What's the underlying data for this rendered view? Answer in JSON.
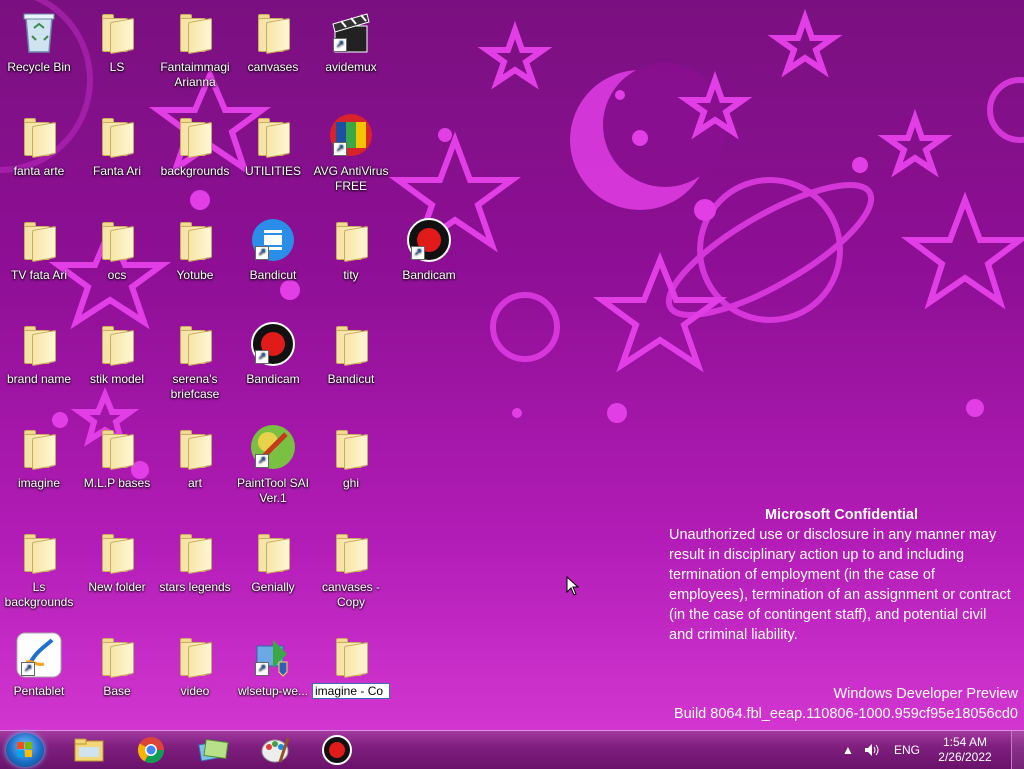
{
  "desktop": {
    "icons": [
      {
        "label": "Recycle Bin",
        "icon": "recycle-bin-icon"
      },
      {
        "label": "LS",
        "icon": "folder-icon"
      },
      {
        "label": "Fantaimmagi Arianna",
        "icon": "folder-icon"
      },
      {
        "label": "canvases",
        "icon": "folder-icon"
      },
      {
        "label": "avidemux",
        "icon": "avidemux-icon"
      },
      {
        "label": "fanta arte",
        "icon": "folder-icon"
      },
      {
        "label": "Fanta Ari",
        "icon": "folder-icon"
      },
      {
        "label": "backgrounds",
        "icon": "folder-icon"
      },
      {
        "label": "UTILITIES",
        "icon": "folder-icon"
      },
      {
        "label": "AVG AntiVirus FREE",
        "icon": "avg-icon"
      },
      {
        "label": "TV  fata Ari",
        "icon": "folder-icon"
      },
      {
        "label": "ocs",
        "icon": "folder-icon"
      },
      {
        "label": "Yotube",
        "icon": "folder-icon"
      },
      {
        "label": "Bandicut",
        "icon": "bandicut-icon"
      },
      {
        "label": "tity",
        "icon": "folder-icon"
      },
      {
        "label": "Bandicam",
        "icon": "bandicam-icon"
      },
      {
        "label": "brand name",
        "icon": "folder-icon"
      },
      {
        "label": "stik  model",
        "icon": "folder-icon"
      },
      {
        "label": "serena's briefcase",
        "icon": "folder-icon"
      },
      {
        "label": "Bandicam",
        "icon": "bandicam-icon"
      },
      {
        "label": "Bandicut",
        "icon": "folder-icon"
      },
      {
        "label": "imagine",
        "icon": "folder-icon"
      },
      {
        "label": "M.L.P bases",
        "icon": "folder-icon"
      },
      {
        "label": "art",
        "icon": "folder-icon"
      },
      {
        "label": "PaintTool SAI Ver.1",
        "icon": "painttool-sai-icon"
      },
      {
        "label": "ghi",
        "icon": "folder-icon"
      },
      {
        "label": "Ls backgrounds",
        "icon": "folder-icon"
      },
      {
        "label": "New folder",
        "icon": "folder-icon"
      },
      {
        "label": "stars legends",
        "icon": "folder-icon"
      },
      {
        "label": "Genially",
        "icon": "folder-icon"
      },
      {
        "label": "canvases - Copy",
        "icon": "folder-icon"
      },
      {
        "label": "Pentablet",
        "icon": "pentablet-icon"
      },
      {
        "label": "Base",
        "icon": "folder-icon"
      },
      {
        "label": "video",
        "icon": "folder-icon"
      },
      {
        "label": "wlsetup-we...",
        "icon": "wlsetup-icon"
      },
      {
        "label": "",
        "icon": "folder-icon"
      }
    ],
    "rename_value": "imagine - Co"
  },
  "confidential": {
    "title": "Microsoft Confidential",
    "body": "Unauthorized use or disclosure in any manner may result in disciplinary action up to and including termination of employment (in the case of employees), termination of an assignment or contract (in the case of contingent staff), and potential civil and criminal liability."
  },
  "watermark": {
    "line1": "Windows Developer Preview",
    "line2": "Build 8064.fbl_eeap.110806-1000.959cf95e18056cd0"
  },
  "taskbar": {
    "pinned": [
      {
        "name": "file-explorer-icon"
      },
      {
        "name": "chrome-icon"
      },
      {
        "name": "windows-photo-viewer-icon"
      },
      {
        "name": "paint-icon"
      },
      {
        "name": "bandicam-icon"
      }
    ],
    "tray": {
      "language": "ENG",
      "time": "1:54 AM",
      "date": "2/26/2022"
    }
  },
  "colors": {
    "wallpaper_top": "#7a1080",
    "wallpaper_bottom": "#d93bd6",
    "taskbar": "#7f1f7f"
  }
}
